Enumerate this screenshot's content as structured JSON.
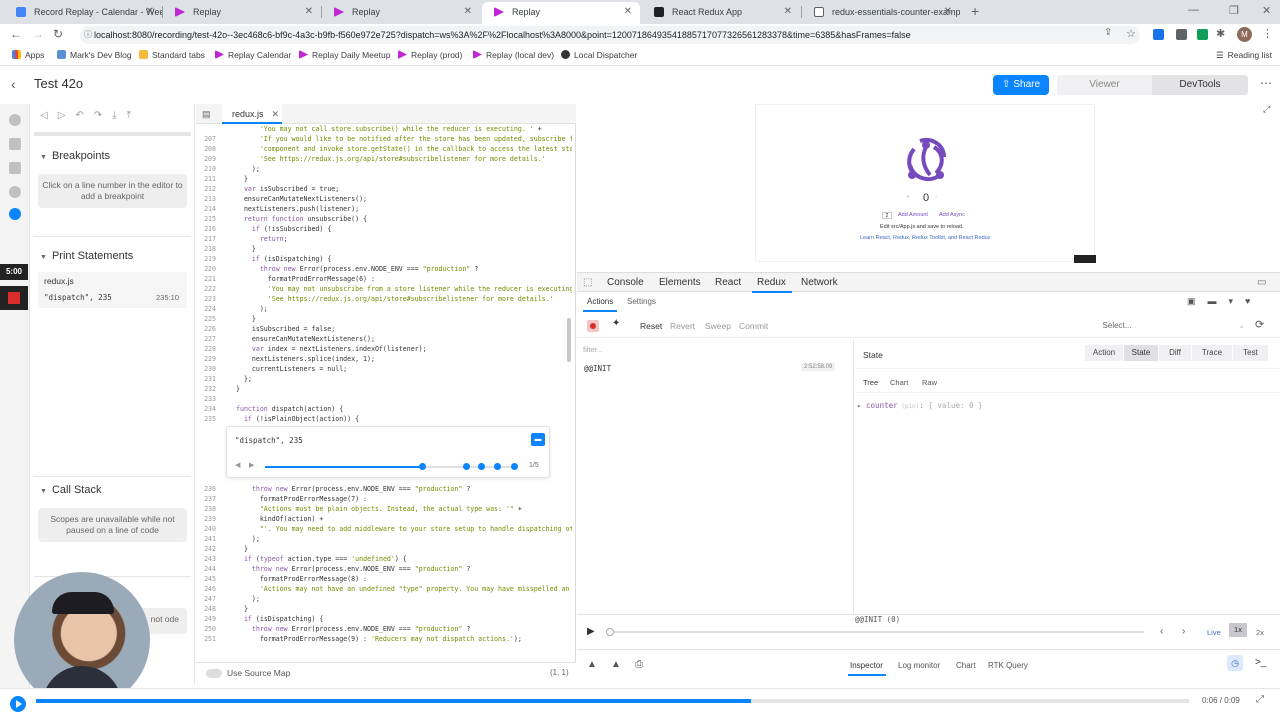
{
  "browser": {
    "tabs": [
      {
        "title": "Record Replay - Calendar - Week",
        "color": "#4285f4"
      },
      {
        "title": "Replay",
        "color": "#c026d3"
      },
      {
        "title": "Replay",
        "color": "#c026d3"
      },
      {
        "title": "Replay",
        "color": "#c026d3"
      },
      {
        "title": "React Redux App",
        "color": "#202124"
      },
      {
        "title": "redux-essentials-counter-example",
        "color": "#202124"
      }
    ],
    "url": "localhost:8080/recording/test-42o--3ec468c6-bf9c-4a3c-b9fb-f560e972e725?dispatch=ws%3A%2F%2Flocalhost%3A8000&point=12007186493541885717077326561283378&time=6385&hasFrames=false",
    "bookmarks": [
      "Apps",
      "Mark's Dev Blog",
      "Standard tabs",
      "Replay Calendar",
      "Replay Daily Meetup",
      "Replay (prod)",
      "Replay (local dev)",
      "Local Dispatcher"
    ],
    "reading_list": "Reading list",
    "avatar_letter": "M"
  },
  "header": {
    "title": "Test 42o",
    "share_label": "Share",
    "viewer_label": "Viewer",
    "devtools_label": "DevTools"
  },
  "sidebar": {
    "record_time": "5:00",
    "breakpoints_title": "Breakpoints",
    "breakpoints_hint": "Click on a line number in the editor to add a breakpoint",
    "print_title": "Print Statements",
    "print_file": "redux.js",
    "print_expr": "\"dispatch\", 235",
    "print_loc": "235:10",
    "callstack_title": "Call Stack",
    "callstack_hint": "Scopes are unavailable while not paused on a line of code",
    "hidden_hint_tail": "not ode"
  },
  "editor": {
    "file_tab": "redux.js",
    "lines_top": [
      {
        "n": "",
        "t": "      'You may not call store.subscribe() while the reducer is executing. ' +"
      },
      {
        "n": "207",
        "t": "      'If you would like to be notified after the store has been updated, subscribe from a ' +"
      },
      {
        "n": "208",
        "t": "      'component and invoke store.getState() in the callback to access the latest state. ' +"
      },
      {
        "n": "209",
        "t": "      'See https://redux.js.org/api/store#subscribelistener for more details.'"
      },
      {
        "n": "210",
        "t": "    );"
      },
      {
        "n": "211",
        "t": "  }"
      },
      {
        "n": "212",
        "t": "  var isSubscribed = true;"
      },
      {
        "n": "213",
        "t": "  ensureCanMutateNextListeners();"
      },
      {
        "n": "214",
        "t": "  nextListeners.push(listener);"
      },
      {
        "n": "215",
        "t": "  return function unsubscribe() {"
      },
      {
        "n": "216",
        "t": "    if (!isSubscribed) {"
      },
      {
        "n": "217",
        "t": "      return;"
      },
      {
        "n": "218",
        "t": "    }"
      },
      {
        "n": "219",
        "t": "    if (isDispatching) {"
      },
      {
        "n": "220",
        "t": "      throw new Error(process.env.NODE_ENV === \"production\" ?"
      },
      {
        "n": "221",
        "t": "        formatProdErrorMessage(6) :"
      },
      {
        "n": "222",
        "t": "        'You may not unsubscribe from a store listener while the reducer is executing. ' +"
      },
      {
        "n": "223",
        "t": "        'See https://redux.js.org/api/store#subscribelistener for more details.'"
      },
      {
        "n": "224",
        "t": "      );"
      },
      {
        "n": "225",
        "t": "    }"
      },
      {
        "n": "226",
        "t": "    isSubscribed = false;"
      },
      {
        "n": "227",
        "t": "    ensureCanMutateNextListeners();"
      },
      {
        "n": "228",
        "t": "    var index = nextListeners.indexOf(listener);"
      },
      {
        "n": "229",
        "t": "    nextListeners.splice(index, 1);"
      },
      {
        "n": "230",
        "t": "    currentListeners = null;"
      },
      {
        "n": "231",
        "t": "  };"
      },
      {
        "n": "232",
        "t": "}"
      },
      {
        "n": "233",
        "t": ""
      },
      {
        "n": "234",
        "t": "function dispatch(action) {"
      },
      {
        "n": "235",
        "t": "  if (!isPlainObject(action)) {"
      }
    ],
    "print_panel": {
      "expr": "\"dispatch\", 235",
      "counter": "1/5"
    },
    "lines_bottom": [
      {
        "n": "236",
        "t": "    throw new Error(process.env.NODE_ENV === \"production\" ?"
      },
      {
        "n": "237",
        "t": "      formatProdErrorMessage(7) :"
      },
      {
        "n": "238",
        "t": "      \"Actions must be plain objects. Instead, the actual type was: '\" +"
      },
      {
        "n": "239",
        "t": "      kindOf(action) +"
      },
      {
        "n": "240",
        "t": "      \"'. You may need to add middleware to your store setup to handle dispatching other values\""
      },
      {
        "n": "241",
        "t": "    );"
      },
      {
        "n": "242",
        "t": "  }"
      },
      {
        "n": "243",
        "t": "  if (typeof action.type === 'undefined') {"
      },
      {
        "n": "244",
        "t": "    throw new Error(process.env.NODE_ENV === \"production\" ?"
      },
      {
        "n": "245",
        "t": "      formatProdErrorMessage(8) :"
      },
      {
        "n": "246",
        "t": "      'Actions may not have an undefined \"type\" property. You may have misspelled an action type string constant.'"
      },
      {
        "n": "247",
        "t": "    );"
      },
      {
        "n": "248",
        "t": "  }"
      },
      {
        "n": "249",
        "t": "  if (isDispatching) {"
      },
      {
        "n": "250",
        "t": "    throw new Error(process.env.NODE_ENV === \"production\" ?"
      },
      {
        "n": "251",
        "t": "      formatProdErrorMessage(9) : 'Reducers may not dispatch actions.');"
      }
    ],
    "source_map_label": "Use Source Map",
    "cursor_pos": "(1, 1)"
  },
  "preview": {
    "counter_value": "0",
    "buttons": [
      "Add Amount",
      "Add Async"
    ],
    "amount": "2",
    "edit_text": "Edit src/App.js and save to reload.",
    "learn_text": "Learn React, Redux, Redux Toolkit, and React Redux"
  },
  "devtools": {
    "tabs": [
      "Console",
      "Elements",
      "React",
      "Redux",
      "Network"
    ],
    "active_tab": "Redux",
    "sub_tabs": [
      "Actions",
      "Settings"
    ],
    "action_buttons": [
      "Reset",
      "Revert",
      "Sweep",
      "Commit"
    ],
    "select_placeholder": "Select...",
    "filter_placeholder": "filter...",
    "state_label": "State",
    "right_tabs": [
      "Action",
      "State",
      "Diff",
      "Trace",
      "Test"
    ],
    "active_right_tab": "State",
    "view_tabs": [
      "Tree",
      "Chart",
      "Raw"
    ],
    "action_item": "@@INIT",
    "action_time": "2:52:58.09",
    "tree_key": "counter",
    "tree_meta": "(pin)",
    "tree_value": "{ value: 0 }",
    "slider_label": "@@INIT (0)",
    "live_label": "Live",
    "speed_1x": "1x",
    "speed_2x": "2x",
    "bottom_tabs": [
      "Inspector",
      "Log monitor",
      "Chart",
      "RTK Query"
    ],
    "active_bottom_tab": "Inspector"
  },
  "timeline": {
    "time": "0:06 / 0:09",
    "progress": 0.62
  },
  "colors": {
    "accent": "#0a84ff",
    "record": "#d92d2d",
    "redux_purple": "#764abc"
  }
}
